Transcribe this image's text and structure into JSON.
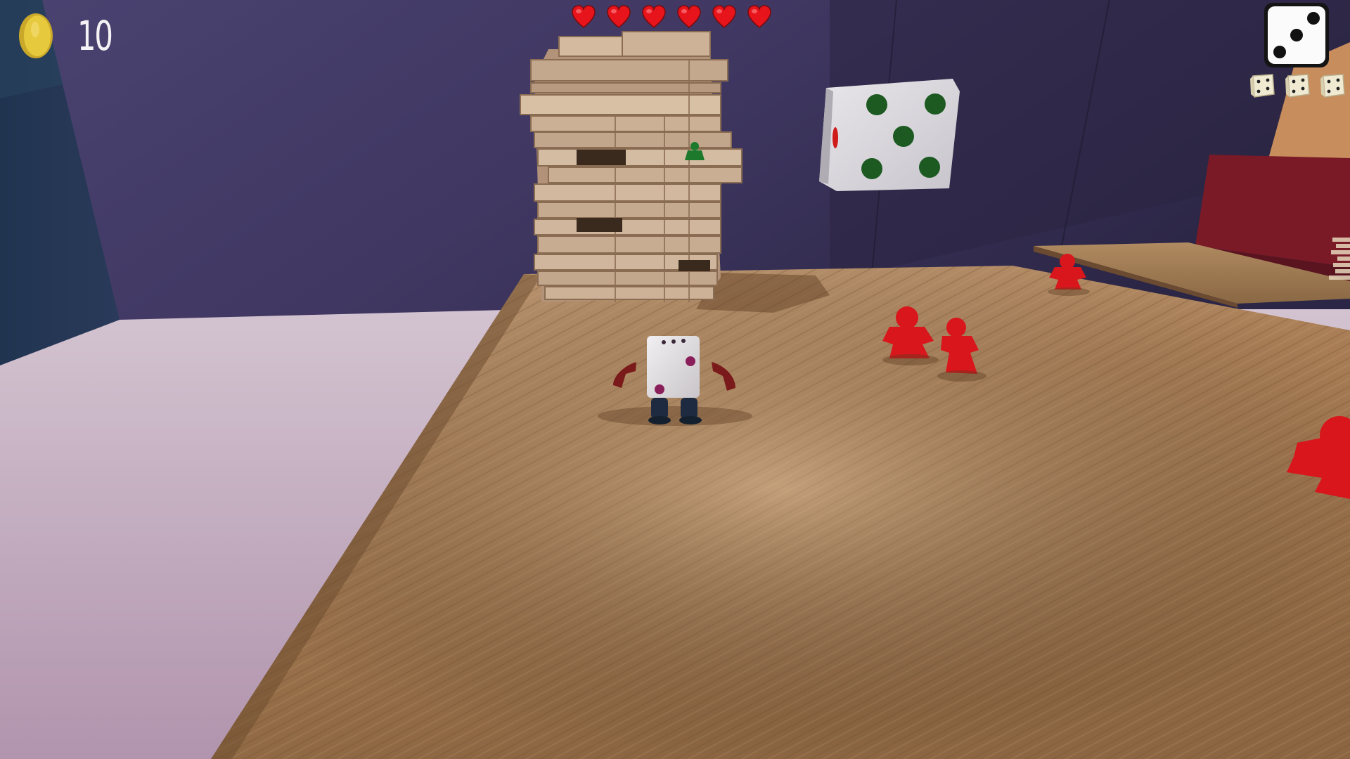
{
  "hud": {
    "coins": {
      "icon": "coin-icon",
      "count": "10",
      "color": "#e6c93c"
    },
    "health": {
      "icon": "heart-icon",
      "hearts_filled": 6,
      "hearts_total": 6,
      "color": "#e8141c"
    },
    "current_die": {
      "icon": "die-face-icon",
      "face_value": 3
    },
    "dice_reserve": {
      "icon": "mini-die-icon",
      "count": 3
    }
  },
  "scene": {
    "player": "dice-character",
    "enemies": [
      "red-meeple",
      "red-meeple",
      "red-meeple",
      "red-meeple"
    ],
    "props": [
      "jenga-tower",
      "giant-green-dot-die",
      "wooden-shelf",
      "green-meeple"
    ],
    "colors": {
      "wall": "#3c3564",
      "floor": "#b89ab0",
      "table": "#9c7450",
      "meeple": "#d8161c",
      "die_pips": "#1c5a22"
    }
  }
}
